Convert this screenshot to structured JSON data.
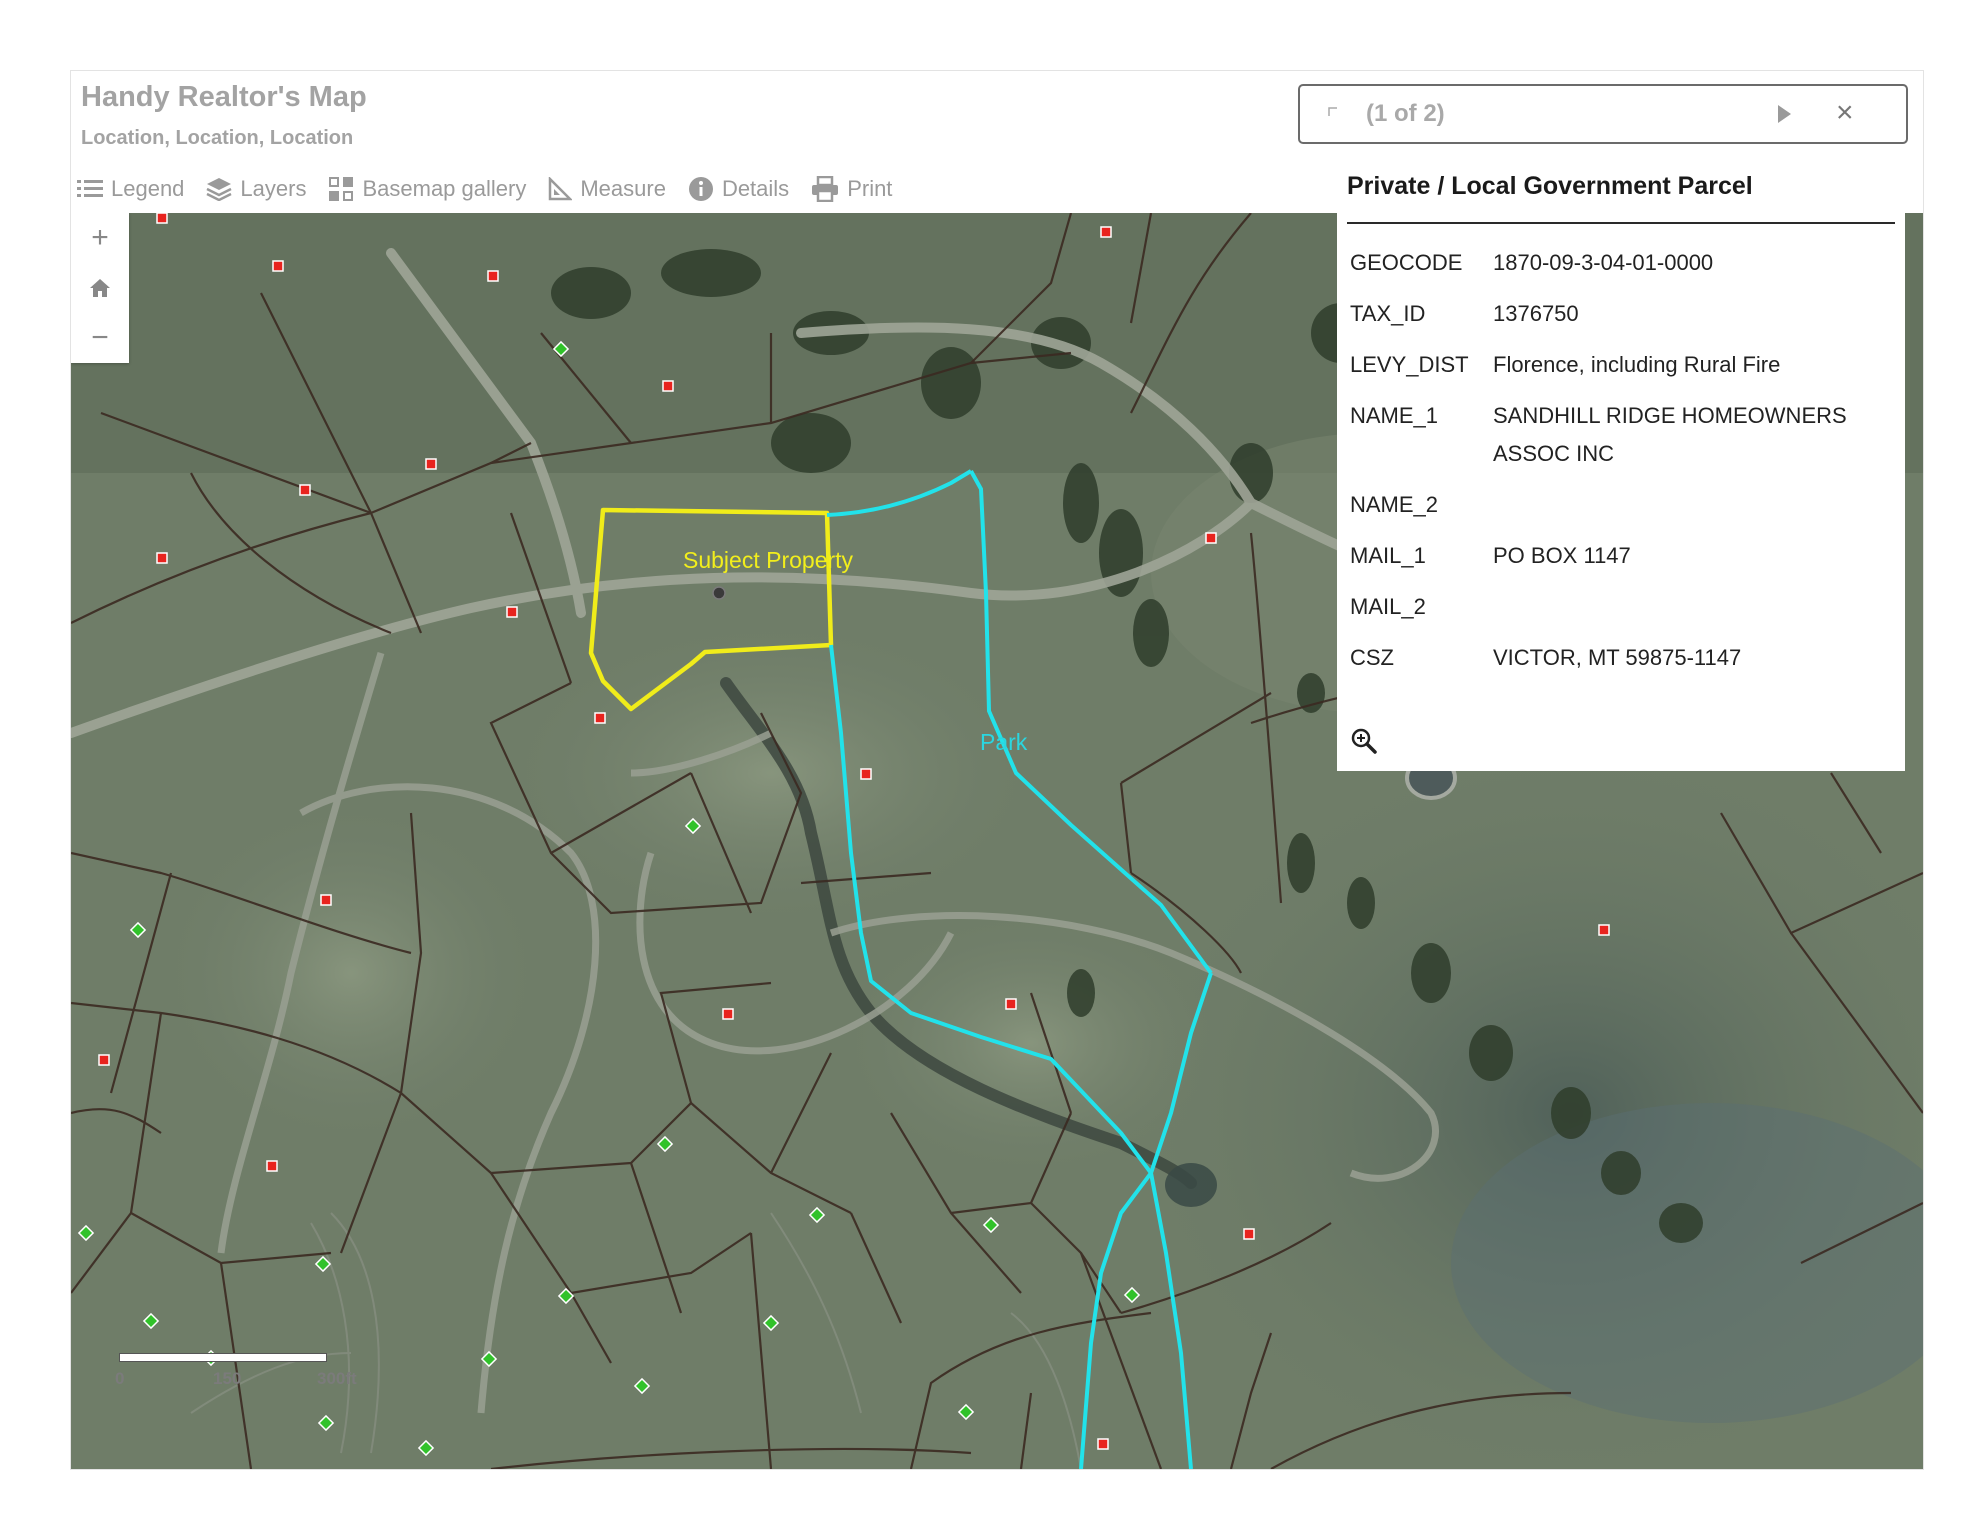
{
  "app": {
    "title": "Handy Realtor's Map",
    "subtitle": "Location, Location, Location"
  },
  "toolbar": {
    "items": [
      {
        "label": "Legend",
        "icon": "legend-icon"
      },
      {
        "label": "Layers",
        "icon": "layers-icon"
      },
      {
        "label": "Basemap gallery",
        "icon": "basemap-gallery-icon"
      },
      {
        "label": "Measure",
        "icon": "measure-icon"
      },
      {
        "label": "Details",
        "icon": "info-icon"
      },
      {
        "label": "Print",
        "icon": "print-icon"
      }
    ]
  },
  "zoom_controls": {
    "zoom_in": "+",
    "home_icon": "home-icon",
    "zoom_out": "−"
  },
  "map": {
    "labels": {
      "subject": "Subject Property",
      "park": "Park"
    },
    "colors": {
      "subject_outline": "#f0ec1a",
      "park_outline": "#22e2ea",
      "parcel_lines": "#3b2a22",
      "improved_parcel_marker": "#e8231e",
      "vacant_parcel_marker": "#31c22a",
      "subject_label": "#f2ee1c",
      "park_label": "#2ad6e0"
    },
    "scale": {
      "ticks": [
        "0",
        "150",
        "300ft"
      ]
    }
  },
  "popup": {
    "counter": "(1 of 2)",
    "prev_icon": "previous-icon",
    "next_icon": "next-icon",
    "close": "×",
    "title": "Private / Local Government Parcel",
    "attributes": [
      {
        "key": "GEOCODE",
        "value": "1870-09-3-04-01-0000"
      },
      {
        "key": "TAX_ID",
        "value": "1376750"
      },
      {
        "key": "LEVY_DIST",
        "value": "Florence, including Rural Fire"
      },
      {
        "key": "NAME_1",
        "value": "SANDHILL RIDGE HOMEOWNERS ASSOC INC"
      },
      {
        "key": "NAME_2",
        "value": ""
      },
      {
        "key": "MAIL_1",
        "value": "PO BOX 1147"
      },
      {
        "key": "MAIL_2",
        "value": ""
      },
      {
        "key": "CSZ",
        "value": "VICTOR, MT 59875-1147"
      }
    ],
    "zoom_to_icon": "zoom-to-icon"
  }
}
